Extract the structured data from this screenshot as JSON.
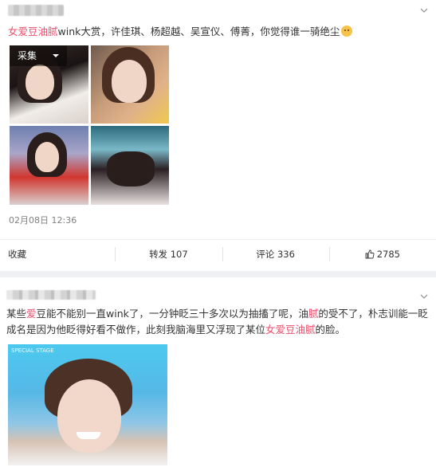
{
  "post1": {
    "text_parts": [
      "女爱豆油腻",
      "wink大赏，许佳琪、杨超越、吴宣仪、傅菁，你觉得谁一骑绝尘"
    ],
    "collect_label": "采集",
    "time": "02月08日 12:36",
    "actions": {
      "collect": "收藏",
      "repost": "转发 107",
      "comment": "评论 336",
      "like": "2785"
    }
  },
  "post2": {
    "text_parts": [
      "某些",
      "爱",
      "豆能不能别一直wink了，一分钟眨三十多次以为抽搐了呢，油",
      "腻",
      "的受不了，朴志训能一眨成名是因为他眨得好看不做作，此刻我脑海里又浮现了某位",
      "女爱豆油腻",
      "的脸。"
    ],
    "stage_logo": "SPECIAL STAGE"
  },
  "colors": {
    "keyword": "#eb4f6c",
    "time": "#808080",
    "background": "#eef0f3"
  }
}
